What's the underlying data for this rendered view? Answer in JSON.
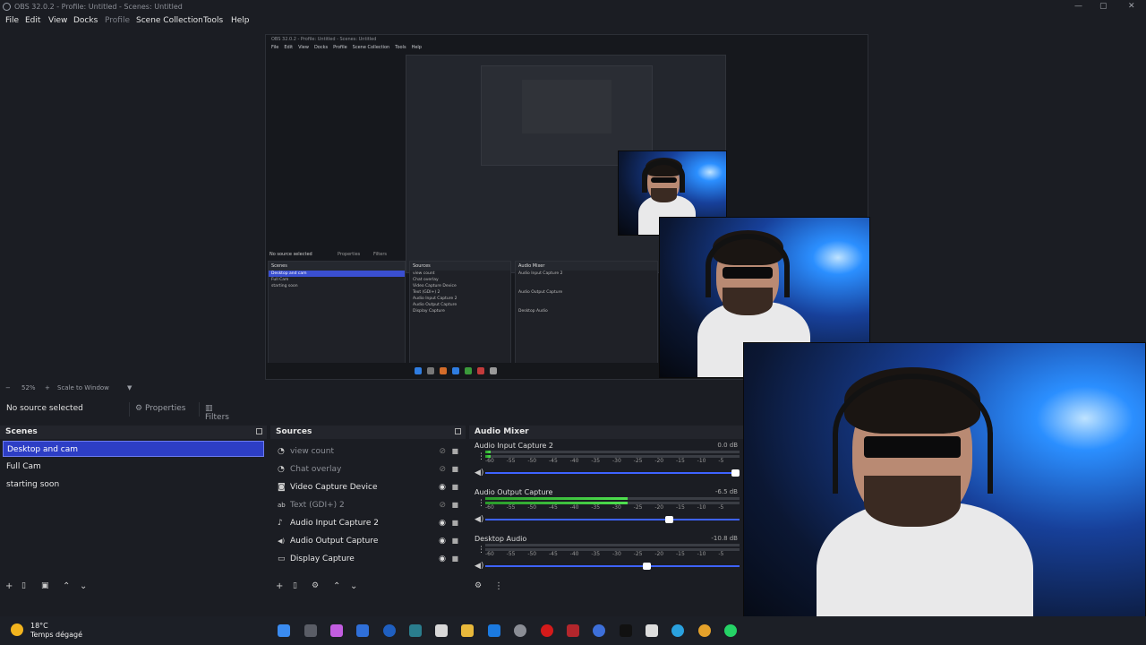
{
  "window": {
    "title": "OBS 32.0.2 - Profile: Untitled - Scenes: Untitled",
    "minimize": "—",
    "maximize": "▢",
    "close": "✕"
  },
  "menu": [
    {
      "label": "File",
      "enabled": true
    },
    {
      "label": "Edit",
      "enabled": true
    },
    {
      "label": "View",
      "enabled": true
    },
    {
      "label": "Docks",
      "enabled": true
    },
    {
      "label": "Profile",
      "enabled": false
    },
    {
      "label": "Scene Collection",
      "enabled": true
    },
    {
      "label": "Tools",
      "enabled": true
    },
    {
      "label": "Help",
      "enabled": true
    }
  ],
  "nested_preview": {
    "title": "OBS 32.0.2 - Profile: Untitled - Scenes: Untitled",
    "menu": [
      "File",
      "Edit",
      "View",
      "Docks",
      "Profile",
      "Scene Collection",
      "Tools",
      "Help"
    ],
    "no_source": "No source selected",
    "properties": "Properties",
    "filters": "Filters",
    "scenes_header": "Scenes",
    "scenes": [
      "Desktop and cam",
      "Full Cam",
      "starting soon"
    ],
    "sources_header": "Sources",
    "sources": [
      "view count",
      "Chat overlay",
      "Video Capture Device",
      "Text (GDI+) 2",
      "Audio Input Capture 2",
      "Audio Output Capture",
      "Display Capture"
    ],
    "mixer_header": "Audio Mixer",
    "mixer": [
      "Audio Input Capture 2",
      "Audio Output Capture",
      "Desktop Audio"
    ]
  },
  "zoom": {
    "minus": "−",
    "level": "52%",
    "plus": "+",
    "mode": "Scale to Window",
    "dropdown": "▼"
  },
  "toolbar": {
    "no_source": "No source selected",
    "properties": "Properties",
    "filters": "Filters"
  },
  "scenes": {
    "header": "Scenes",
    "items": [
      {
        "label": "Desktop and cam",
        "active": true
      },
      {
        "label": "Full Cam",
        "active": false
      },
      {
        "label": "starting soon",
        "active": false
      }
    ]
  },
  "sources": {
    "header": "Sources",
    "items": [
      {
        "label": "view count",
        "icon": "text-icon",
        "glyph": "◔",
        "visible": false
      },
      {
        "label": "Chat overlay",
        "icon": "browser-icon",
        "glyph": "◔",
        "visible": false
      },
      {
        "label": "Video Capture Device",
        "icon": "camera-icon",
        "glyph": "◙",
        "visible": true
      },
      {
        "label": "Text (GDI+) 2",
        "icon": "text-icon",
        "glyph": "ab",
        "visible": false
      },
      {
        "label": "Audio Input Capture 2",
        "icon": "microphone-icon",
        "glyph": "♪",
        "visible": true
      },
      {
        "label": "Audio Output Capture",
        "icon": "speaker-icon",
        "glyph": "◀)",
        "visible": true
      },
      {
        "label": "Display Capture",
        "icon": "monitor-icon",
        "glyph": "▭",
        "visible": true
      }
    ]
  },
  "mixer": {
    "header": "Audio Mixer",
    "scale": [
      "-60",
      "-55",
      "-50",
      "-45",
      "-40",
      "-35",
      "-30",
      "-25",
      "-20",
      "-15",
      "-10",
      "-5"
    ],
    "channels": [
      {
        "name": "Audio Input Capture 2",
        "db": "0.0 dB",
        "level": 0.02,
        "fader": 1.0
      },
      {
        "name": "Audio Output Capture",
        "db": "-6.5 dB",
        "level": 0.56,
        "fader": 0.74
      },
      {
        "name": "Desktop Audio",
        "db": "-10.8 dB",
        "level": 0.0,
        "fader": 0.65
      }
    ]
  },
  "footer": {
    "add": "+",
    "remove": "🗑",
    "filter": "▣",
    "settings": "⚙",
    "up": "⌃",
    "down": "⌄",
    "mixer_settings": "⚙",
    "more": "⋮"
  },
  "taskbar": {
    "temp": "18°C",
    "weather": "Temps dégagé"
  },
  "colors": {
    "accent": "#2d3ec5",
    "meter_green": "#4fe14f",
    "background": "#1b1d23"
  }
}
